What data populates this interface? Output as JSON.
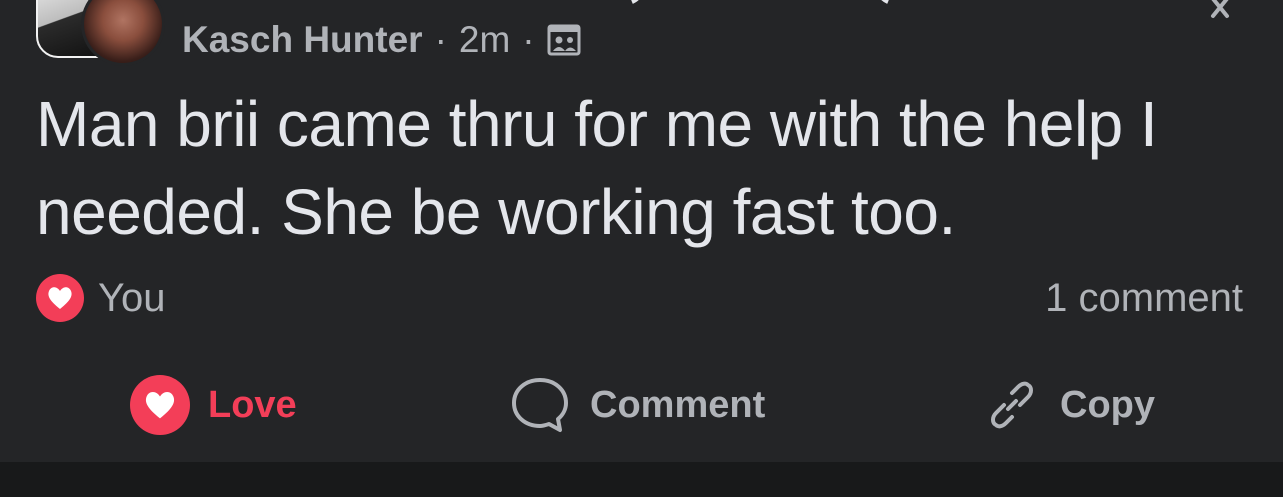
{
  "post": {
    "author": "Kasch Hunter",
    "time": "2m",
    "separator": "·",
    "audience_icon": "photo-audience-icon",
    "text": "Man brii came thru for me with the help I needed. She be working fast too."
  },
  "reactions": {
    "icon": "heart-icon",
    "names": "You",
    "comment_count": "1 comment"
  },
  "actions": {
    "love_label": "Love",
    "comment_label": "Comment",
    "copy_label": "Copy"
  },
  "colors": {
    "background": "#242527",
    "text": "#e4e6eb",
    "secondary_text": "#b0b3b8",
    "love": "#f33e58",
    "separator": "#18191a"
  }
}
